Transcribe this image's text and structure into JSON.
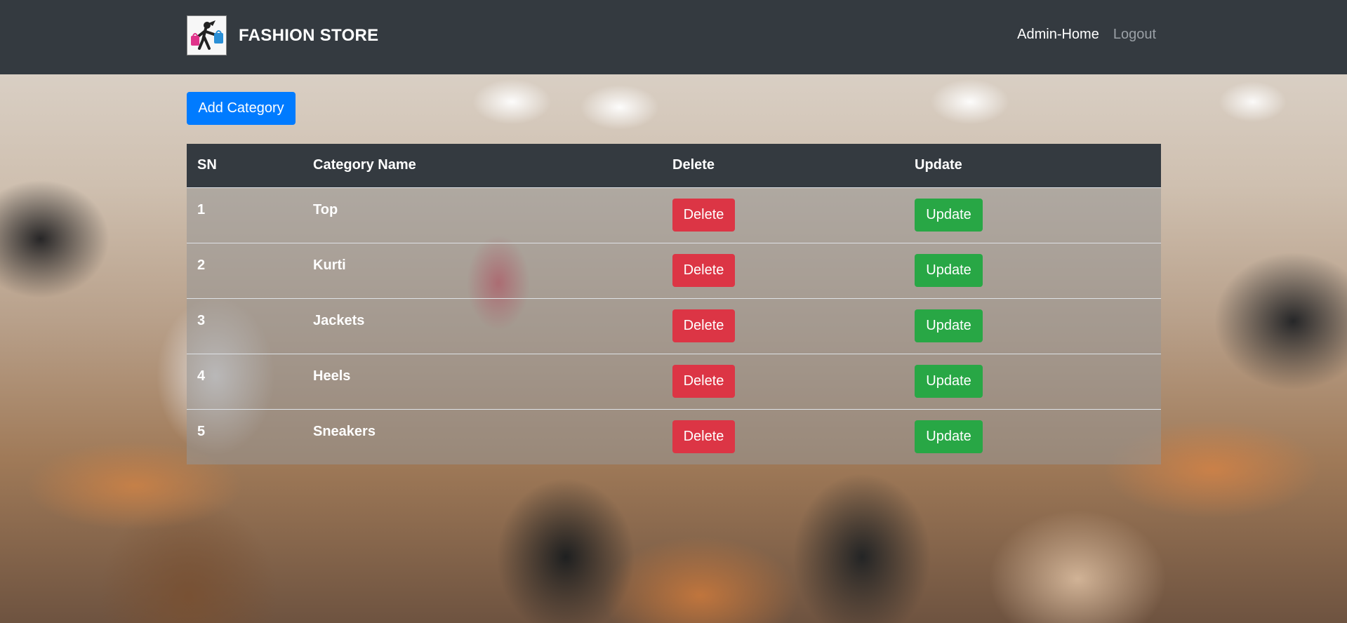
{
  "navbar": {
    "brand": "FASHION STORE",
    "links": [
      "Admin-Home",
      "Logout"
    ]
  },
  "actions": {
    "add_category": "Add Category"
  },
  "table": {
    "headers": [
      "SN",
      "Category Name",
      "Delete",
      "Update"
    ],
    "rows": [
      {
        "sn": "1",
        "name": "Top",
        "delete": "Delete",
        "update": "Update"
      },
      {
        "sn": "2",
        "name": "Kurti",
        "delete": "Delete",
        "update": "Update"
      },
      {
        "sn": "3",
        "name": "Jackets",
        "delete": "Delete",
        "update": "Update"
      },
      {
        "sn": "4",
        "name": "Heels",
        "delete": "Delete",
        "update": "Update"
      },
      {
        "sn": "5",
        "name": "Sneakers",
        "delete": "Delete",
        "update": "Update"
      }
    ]
  },
  "colors": {
    "navbar": "#343a40",
    "primary": "#007bff",
    "danger": "#dc3545",
    "success": "#28a745"
  },
  "icons": {
    "logo": "shopper-with-bags-logo"
  }
}
